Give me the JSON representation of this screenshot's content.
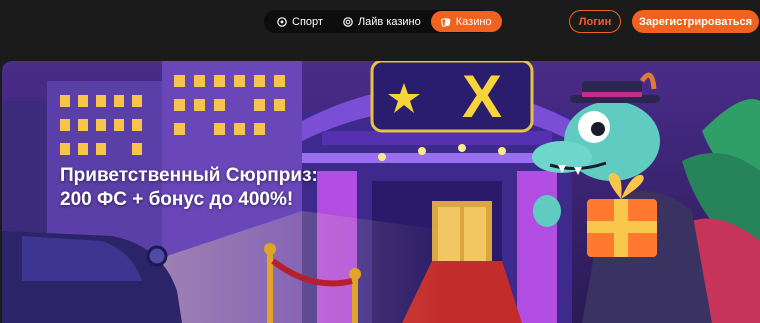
{
  "nav": {
    "items": [
      {
        "label": "Спорт",
        "icon": "soccer-ball-icon",
        "active": false
      },
      {
        "label": "Лайв казино",
        "icon": "chip-icon",
        "active": false
      },
      {
        "label": "Казино",
        "icon": "cards-icon",
        "active": true
      }
    ]
  },
  "auth": {
    "login_label": "Логин",
    "register_label": "Зарегистрироваться"
  },
  "banner": {
    "title_line1": "Приветственный Сюрприз:",
    "title_line2": "200 ФС + бонус до 400%!",
    "sign_letter": "X"
  },
  "colors": {
    "accent": "#f0621f",
    "background": "#1b1b1b"
  }
}
